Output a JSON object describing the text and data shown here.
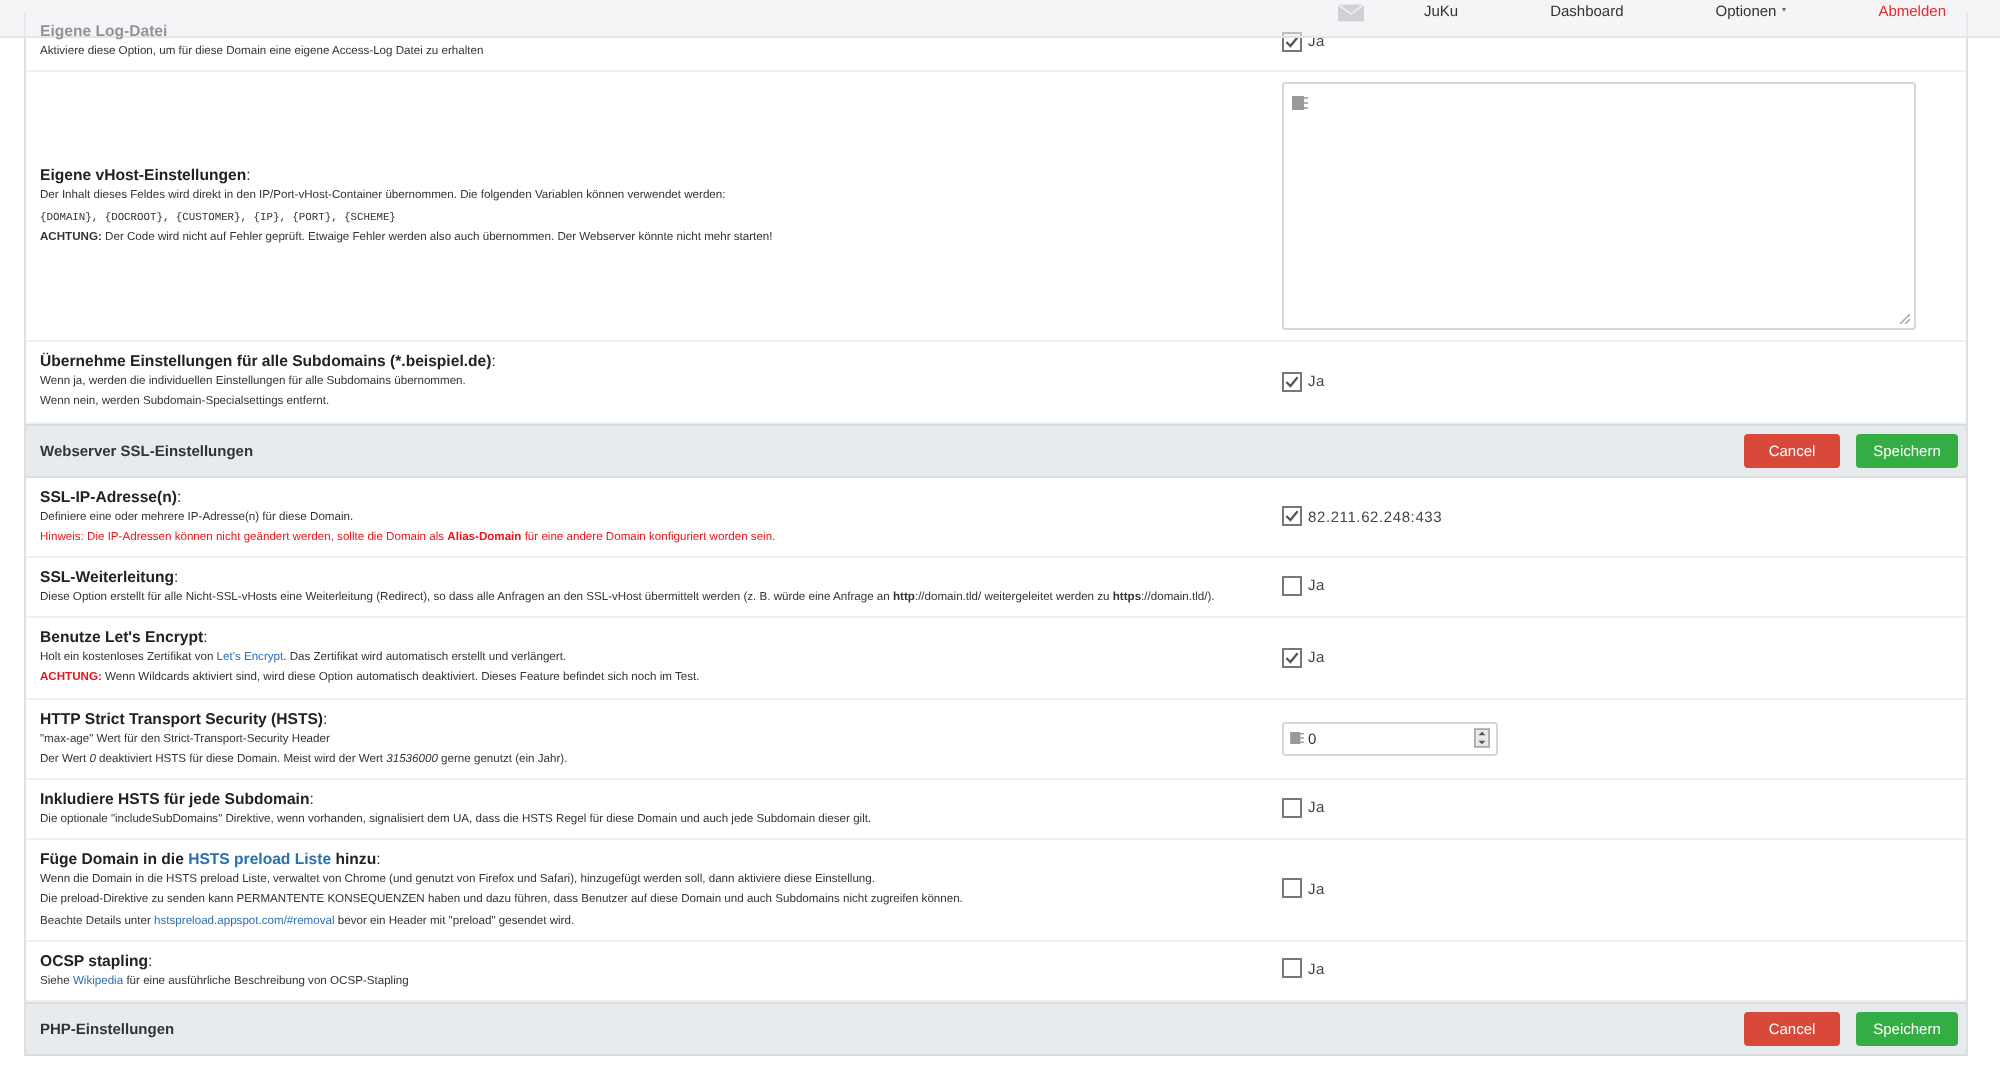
{
  "navbar": {
    "items": [
      {
        "label": "JuKu",
        "kind": "plain"
      },
      {
        "label": "Dashboard",
        "kind": "plain"
      },
      {
        "label": "Optionen",
        "kind": "dropdown"
      },
      {
        "label": "Abmelden",
        "kind": "danger"
      }
    ]
  },
  "rows": [
    {
      "kind": "option",
      "title": [
        {
          "kind": "text",
          "text": "Eigene Log-Datei"
        }
      ],
      "lines": [
        [
          {
            "kind": "text",
            "text": "Aktiviere diese Option, um für diese Domain eine eigene Access-Log Datei zu erhalten"
          }
        ]
      ],
      "control": {
        "kind": "checkbox",
        "checked": true,
        "label": "Ja"
      }
    },
    {
      "kind": "option",
      "title": [
        {
          "kind": "text",
          "text": "Eigene vHost-Einstellungen"
        },
        {
          "kind": "suffix",
          "text": ":"
        }
      ],
      "lines": [
        [
          {
            "kind": "text",
            "text": "Der Inhalt dieses Feldes wird direkt in den IP/Port-vHost-Container übernommen. Die folgenden Variablen können verwendet werden:"
          }
        ],
        [
          {
            "kind": "code",
            "text": "{DOMAIN}, {DOCROOT}, {CUSTOMER}, {IP}, {PORT}, {SCHEME}"
          }
        ],
        [
          {
            "kind": "text",
            "text": "**ACHTUNG:** Der Code wird nicht auf Fehler geprüft. Etwaige Fehler werden also auch übernommen. Der Webserver könnte nicht mehr starten!"
          }
        ]
      ],
      "control": {
        "kind": "textarea"
      }
    },
    {
      "kind": "option",
      "title": [
        {
          "kind": "text",
          "text": "Übernehme Einstellungen für alle Subdomains (*.beispiel.de)"
        },
        {
          "kind": "suffix",
          "text": ":"
        }
      ],
      "lines": [
        [
          {
            "kind": "text",
            "text": "Wenn ja, werden die individuellen Einstellungen für alle Subdomains übernommen."
          }
        ],
        [
          {
            "kind": "text",
            "text": "Wenn nein, werden Subdomain-Specialsettings entfernt."
          }
        ]
      ],
      "control": {
        "kind": "checkbox",
        "checked": true,
        "label": "Ja"
      }
    },
    {
      "kind": "section",
      "title": "Webserver SSL-Einstellungen",
      "buttons": [
        {
          "label": "Cancel",
          "kind": "danger"
        },
        {
          "label": "Speichern",
          "kind": "success"
        }
      ]
    },
    {
      "kind": "option",
      "title": [
        {
          "kind": "text",
          "text": "SSL-IP-Adresse(n)"
        },
        {
          "kind": "suffix",
          "text": ":"
        }
      ],
      "lines": [
        [
          {
            "kind": "text",
            "text": "Definiere eine oder mehrere IP-Adresse(n) für diese Domain."
          }
        ],
        [
          {
            "kind": "warning",
            "text": "Hinweis: Die IP-Adressen können nicht geändert werden, sollte die Domain als **Alias-Domain** für eine andere Domain konfiguriert worden sein."
          }
        ]
      ],
      "control": {
        "kind": "checkbox",
        "checked": true,
        "label": "82.211.62.248:433"
      }
    },
    {
      "kind": "option",
      "title": [
        {
          "kind": "text",
          "text": "SSL-Weiterleitung"
        },
        {
          "kind": "suffix",
          "text": ":"
        }
      ],
      "lines": [
        [
          {
            "kind": "text",
            "text": "Diese Option erstellt für alle Nicht-SSL-vHosts eine Weiterleitung (Redirect), so dass alle Anfragen an den SSL-vHost übermittelt werden (z. B. würde eine Anfrage an **http**://domain.tld/ weitergeleitet werden zu **https**://domain.tld/)."
          }
        ]
      ],
      "control": {
        "kind": "checkbox",
        "checked": false,
        "label": "Ja"
      }
    },
    {
      "kind": "option",
      "title": [
        {
          "kind": "text",
          "text": "Benutze Let's Encrypt"
        },
        {
          "kind": "suffix",
          "text": ":"
        }
      ],
      "lines": [
        [
          {
            "kind": "text",
            "text": "Holt ein kostenloses Zertifikat von "
          },
          {
            "kind": "link",
            "text": "Let's Encrypt"
          },
          {
            "kind": "text",
            "text": ". Das Zertifikat wird automatisch erstellt und verlängert."
          }
        ],
        [
          {
            "kind": "alert",
            "text": "ACHTUNG:"
          },
          {
            "kind": "text",
            "text": " Wenn Wildcards aktiviert sind, wird diese Option automatisch deaktiviert. Dieses Feature befindet sich noch im Test."
          }
        ]
      ],
      "control": {
        "kind": "checkbox",
        "checked": true,
        "label": "Ja"
      }
    },
    {
      "kind": "option",
      "title": [
        {
          "kind": "text",
          "text": "HTTP Strict Transport Security (HSTS)"
        },
        {
          "kind": "suffix",
          "text": ":"
        }
      ],
      "lines": [
        [
          {
            "kind": "text",
            "text": "\"max-age\" Wert für den Strict-Transport-Security Header"
          }
        ],
        [
          {
            "kind": "text",
            "text": "Der Wert *0* deaktiviert HSTS für diese Domain. Meist wird der Wert *31536000* gerne genutzt (ein Jahr)."
          }
        ]
      ],
      "control": {
        "kind": "number",
        "value": "0"
      }
    },
    {
      "kind": "option",
      "title": [
        {
          "kind": "text",
          "text": "Inkludiere HSTS für jede Subdomain"
        },
        {
          "kind": "suffix",
          "text": ":"
        }
      ],
      "lines": [
        [
          {
            "kind": "text",
            "text": "Die optionale \"includeSubDomains\" Direktive, wenn vorhanden, signalisiert dem UA, dass die HSTS Regel für diese Domain und auch jede Subdomain dieser gilt."
          }
        ]
      ],
      "control": {
        "kind": "checkbox",
        "checked": false,
        "label": "Ja"
      }
    },
    {
      "kind": "option",
      "title": [
        {
          "kind": "text",
          "text": "Füge Domain in die "
        },
        {
          "kind": "link",
          "text": "HSTS preload Liste"
        },
        {
          "kind": "text",
          "text": " hinzu"
        },
        {
          "kind": "suffix",
          "text": ":"
        }
      ],
      "lines": [
        [
          {
            "kind": "text",
            "text": "Wenn die Domain in die HSTS preload Liste, verwaltet von Chrome (und genutzt von Firefox und Safari), hinzugefügt werden soll, dann aktiviere diese Einstellung."
          }
        ],
        [
          {
            "kind": "text",
            "text": "Die preload-Direktive zu senden kann PERMANTENTE KONSEQUENZEN haben und dazu führen, dass Benutzer auf diese Domain und auch Subdomains nicht zugreifen können."
          }
        ],
        [
          {
            "kind": "text",
            "text": "Beachte Details unter "
          },
          {
            "kind": "link",
            "text": "hstspreload.appspot.com/#removal"
          },
          {
            "kind": "text",
            "text": " bevor ein Header mit \"preload\" gesendet wird."
          }
        ]
      ],
      "control": {
        "kind": "checkbox",
        "checked": false,
        "label": "Ja"
      }
    },
    {
      "kind": "option",
      "title": [
        {
          "kind": "text",
          "text": "OCSP stapling"
        },
        {
          "kind": "suffix",
          "text": ":"
        }
      ],
      "lines": [
        [
          {
            "kind": "text",
            "text": "Siehe "
          },
          {
            "kind": "link",
            "text": "Wikipedia"
          },
          {
            "kind": "text",
            "text": " für eine ausführliche Beschreibung von OCSP-Stapling"
          }
        ]
      ],
      "control": {
        "kind": "checkbox",
        "checked": false,
        "label": "Ja"
      }
    },
    {
      "kind": "section",
      "title": "PHP-Einstellungen",
      "buttons": [
        {
          "label": "Cancel",
          "kind": "danger"
        },
        {
          "label": "Speichern",
          "kind": "success"
        }
      ]
    }
  ]
}
